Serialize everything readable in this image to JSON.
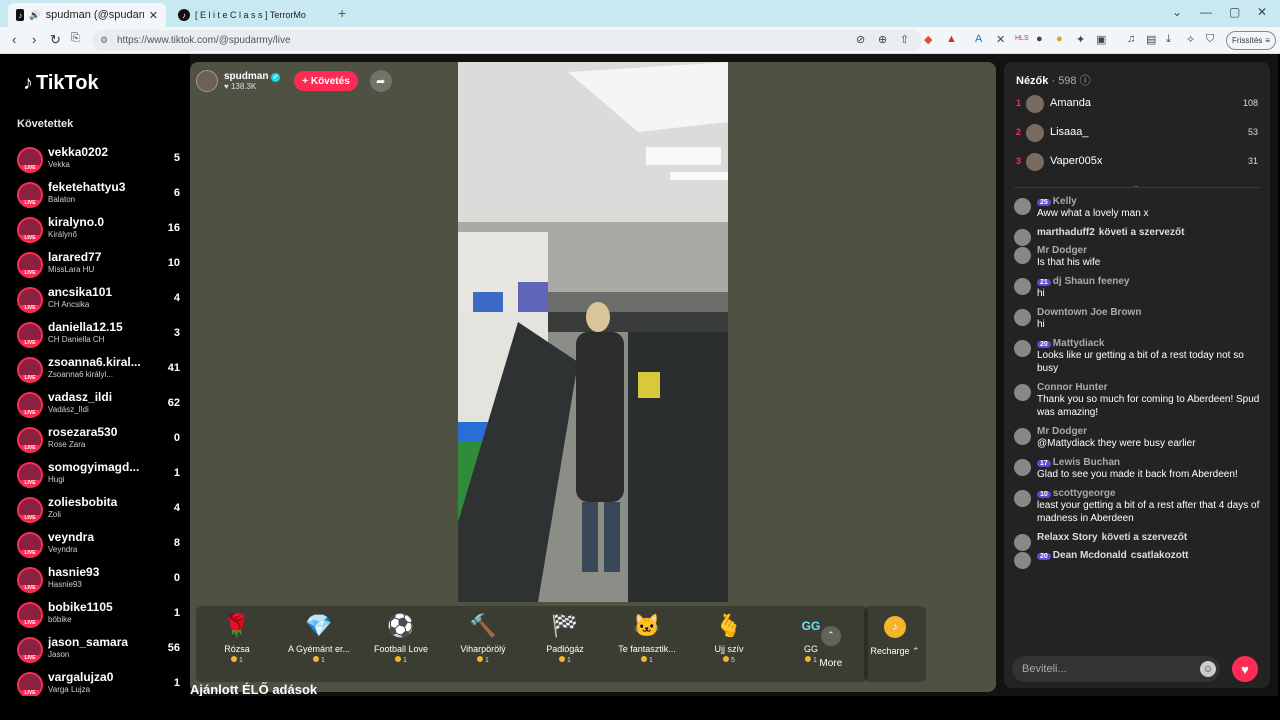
{
  "browser": {
    "tabs": [
      {
        "title": "spudman (@spudarmy) ÉLŐ",
        "active": true
      },
      {
        "title": "[ E l i t e   C l a s s ] TerrorMo",
        "active": false
      }
    ],
    "url": "https://www.tiktok.com/@spudarmy/live",
    "update_label": "Frissítés"
  },
  "sidebar": {
    "logo": "TikTok",
    "following_title": "Követettek",
    "items": [
      {
        "name": "vekka0202",
        "sub": "Vekka",
        "count": "5"
      },
      {
        "name": "feketehattyu3",
        "sub": "Balaton",
        "count": "6"
      },
      {
        "name": "kiralyno.0",
        "sub": "Királynő",
        "count": "16"
      },
      {
        "name": "larared77",
        "sub": "MissLara HU",
        "count": "10"
      },
      {
        "name": "ancsika101",
        "sub": "CH Ancsika",
        "count": "4"
      },
      {
        "name": "daniella12.15",
        "sub": "CH Daniella CH",
        "count": "3"
      },
      {
        "name": "zsoanna6.kiral...",
        "sub": "Zsoanna6 királyl...",
        "count": "41"
      },
      {
        "name": "vadasz_ildi",
        "sub": "Vadász_Ildi",
        "count": "62"
      },
      {
        "name": "rosezara530",
        "sub": "Rose Zara",
        "count": "0"
      },
      {
        "name": "somogyimagd...",
        "sub": "Hugi",
        "count": "1"
      },
      {
        "name": "zoliesbobita",
        "sub": "Zoli",
        "count": "4"
      },
      {
        "name": "veyndra",
        "sub": "Veyndra",
        "count": "8"
      },
      {
        "name": "hasnie93",
        "sub": "Hasnie93",
        "count": "0"
      },
      {
        "name": "bobike1105",
        "sub": "böbike",
        "count": "1"
      },
      {
        "name": "jason_samara",
        "sub": "Jason",
        "count": "56"
      },
      {
        "name": "vargalujza0",
        "sub": "Varga Lujza",
        "count": "1"
      }
    ]
  },
  "host": {
    "name": "spudman",
    "likes": "138.3K",
    "follow_label": "+ Követés"
  },
  "gifts": [
    {
      "name": "Rózsa",
      "price": "1",
      "icon": "rose-icon",
      "glyph": "🌹"
    },
    {
      "name": "A Gyémánt er...",
      "price": "1",
      "icon": "diamond-icon",
      "glyph": "💎"
    },
    {
      "name": "Football Love",
      "price": "1",
      "icon": "football-icon",
      "glyph": "⚽"
    },
    {
      "name": "Viharpörölý",
      "price": "1",
      "icon": "hammer-icon",
      "glyph": "🔨"
    },
    {
      "name": "Padlógáz",
      "price": "1",
      "icon": "wheel-icon",
      "glyph": "🏁"
    },
    {
      "name": "Te fantasztik...",
      "price": "1",
      "icon": "cat-icon",
      "glyph": "🐱"
    },
    {
      "name": "Ujj szív",
      "price": "5",
      "icon": "finger-heart-icon",
      "glyph": "🫰"
    },
    {
      "name": "GG",
      "price": "1",
      "icon": "gg-icon",
      "glyph": "GG"
    }
  ],
  "more_label": "More",
  "recharge_label": "Recharge",
  "recommended_title": "Ajánlott ÉLŐ adások",
  "chat": {
    "viewers_label": "Nézők",
    "viewers_count": "· 598",
    "top": [
      {
        "rank": "1",
        "name": "Amanda",
        "score": "108"
      },
      {
        "rank": "2",
        "name": "Lisaaa_",
        "score": "53"
      },
      {
        "rank": "3",
        "name": "Vaper005x",
        "score": "31"
      }
    ],
    "messages": [
      {
        "user": "Kelly",
        "badge": "25",
        "text": "Aww what a lovely man x"
      },
      {
        "user": "marthaduff2",
        "system": "követi a szervezőt"
      },
      {
        "user": "Mr Dodger",
        "text": "Is that his wife"
      },
      {
        "user": "dj Shaun feeney",
        "badge": "21",
        "text": "hi"
      },
      {
        "user": "Downtown Joe Brown",
        "text": "hi"
      },
      {
        "user": "Mattydiack",
        "badge": "20",
        "text": "Looks like ur getting a bit of a rest today not so busy"
      },
      {
        "user": "Connor Hunter",
        "text": "Thank you so much for coming to Aberdeen! Spud was amazing!"
      },
      {
        "user": "Mr Dodger",
        "text": "@Mattydiack they were busy earlier"
      },
      {
        "user": "Lewis Buchan",
        "badge": "17",
        "text": "Glad to see you made it back from Aberdeen!"
      },
      {
        "user": "scottygeorge",
        "badge": "10",
        "text": "least your getting a bit of a rest after that 4 days of madness in Aberdeen"
      },
      {
        "user": "Relaxx Story",
        "system": "követi a szervezőt"
      },
      {
        "user": "Dean Mcdonald",
        "badge": "20",
        "system": "csatlakozott"
      }
    ],
    "input_placeholder": "Beviteli..."
  }
}
